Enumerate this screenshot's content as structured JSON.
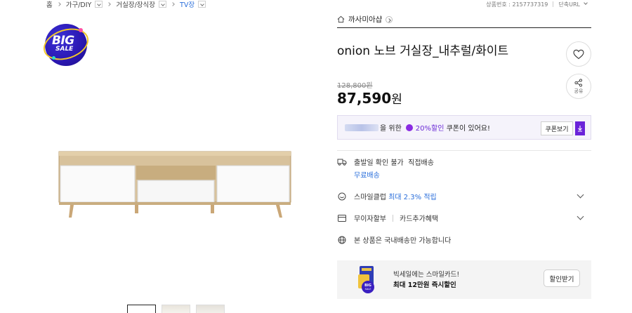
{
  "breadcrumb": {
    "items": [
      {
        "label": "홈",
        "dropdown": false
      },
      {
        "label": "가구/DIY",
        "dropdown": true
      },
      {
        "label": "거실장/장식장",
        "dropdown": true
      },
      {
        "label": "TV장",
        "dropdown": true,
        "current": true
      }
    ]
  },
  "meta": {
    "product_number": "상품번호 : 2157737319",
    "short_url": "단축URL"
  },
  "badge": {
    "line1": "BIG",
    "line2": "SALE"
  },
  "shop": {
    "name": "까사미아샵"
  },
  "product": {
    "title": "onion 노브 거실장_내추럴/화이트",
    "original_price": "128,800원",
    "price": "87,590",
    "price_unit": "원"
  },
  "share": {
    "label": "공유"
  },
  "coupon": {
    "prefix": "을 위한",
    "highlight": "20%할인",
    "suffix": "쿠폰이 있어요!",
    "button": "쿠폰보기"
  },
  "shipping": {
    "line1": "출발일 확인 불가",
    "line1b": "직접배송",
    "line2": "무료배송"
  },
  "smile_club": {
    "label": "스마일클럽",
    "highlight": "최대 2.3% 적립"
  },
  "installment": {
    "label": "무이자할부",
    "extra": "카드추가혜택"
  },
  "delivery_note": {
    "label": "본 상품은 국내배송만 가능합니다"
  },
  "promo": {
    "line1": "빅세일에는 스마일카드!",
    "line2": "최대 12만원 즉시할인",
    "button": "할인받기"
  },
  "colors": {
    "accent_purple": "#6a23d9",
    "link_blue": "#2b6fdb"
  }
}
